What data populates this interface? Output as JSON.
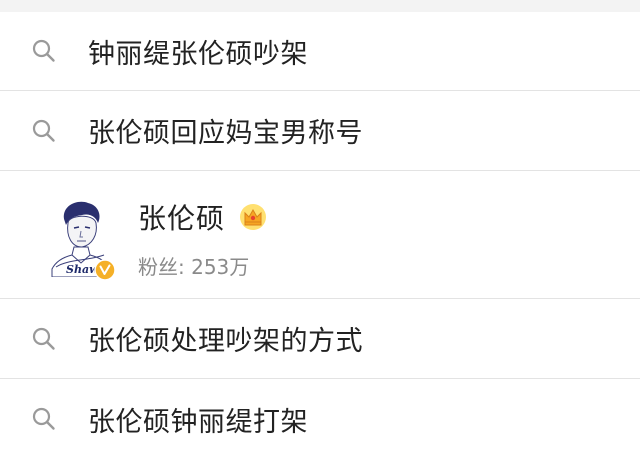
{
  "suggestions_top": [
    {
      "text": "钟丽缇张伦硕吵架",
      "icon": "search-icon"
    },
    {
      "text": "张伦硕回应妈宝男称号",
      "icon": "search-icon"
    }
  ],
  "user_result": {
    "name": "张伦硕",
    "badge": "crown-icon",
    "verified": "verified-badge",
    "avatar": "avatar",
    "fans_label": "粉丝:",
    "fans_value": "253万",
    "avatar_signature": "Shawn"
  },
  "suggestions_bottom": [
    {
      "text": "张伦硕处理吵架的方式",
      "icon": "search-icon"
    },
    {
      "text": "张伦硕钟丽缇打架",
      "icon": "search-icon"
    }
  ],
  "colors": {
    "background": "#f3f3f3",
    "text": "#222222",
    "secondary_text": "#8a8a8a",
    "divider": "#e3e3e3",
    "verified": "#f5b027",
    "crown": "#f6a623"
  }
}
